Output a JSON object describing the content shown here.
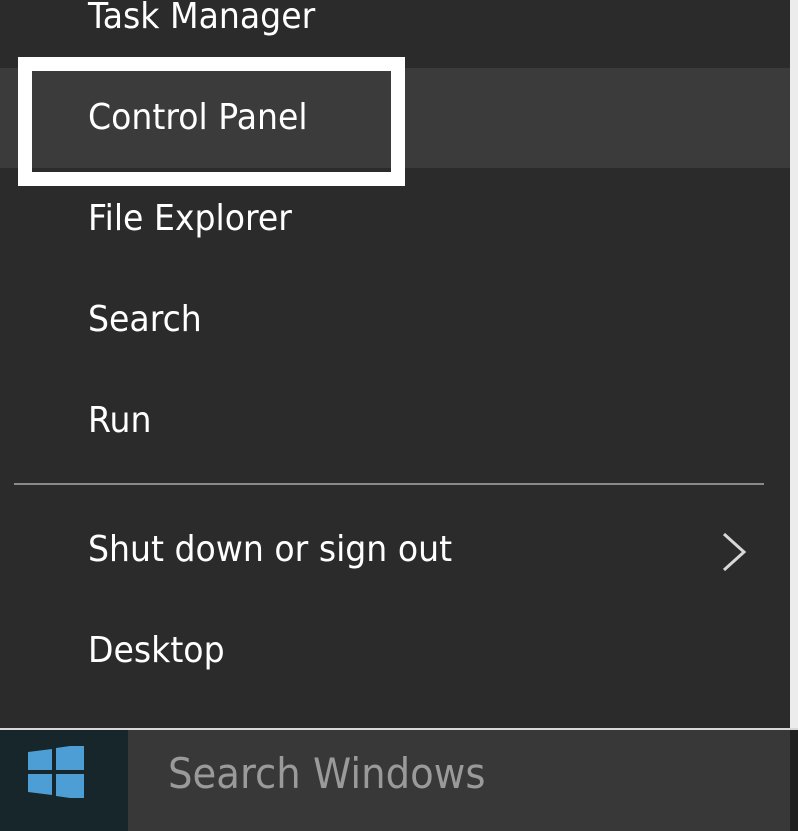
{
  "menu": {
    "items": [
      {
        "label": "Task Manager"
      },
      {
        "label": "Control Panel",
        "highlighted": true
      },
      {
        "label": "File Explorer"
      },
      {
        "label": "Search"
      },
      {
        "label": "Run"
      },
      {
        "label": "Shut down or sign out",
        "has_submenu": true
      },
      {
        "label": "Desktop"
      }
    ]
  },
  "taskbar": {
    "start_icon": "windows-logo-icon",
    "search_placeholder": "Search Windows"
  },
  "colors": {
    "menu_background": "#2b2b2b",
    "active_item_background": "#3b3b3b",
    "highlight_box": "#ffffff",
    "start_button_background": "#17262a",
    "windows_logo": "#4d9ed5",
    "search_box_background": "#383838",
    "search_text": "#9a9a9a"
  }
}
